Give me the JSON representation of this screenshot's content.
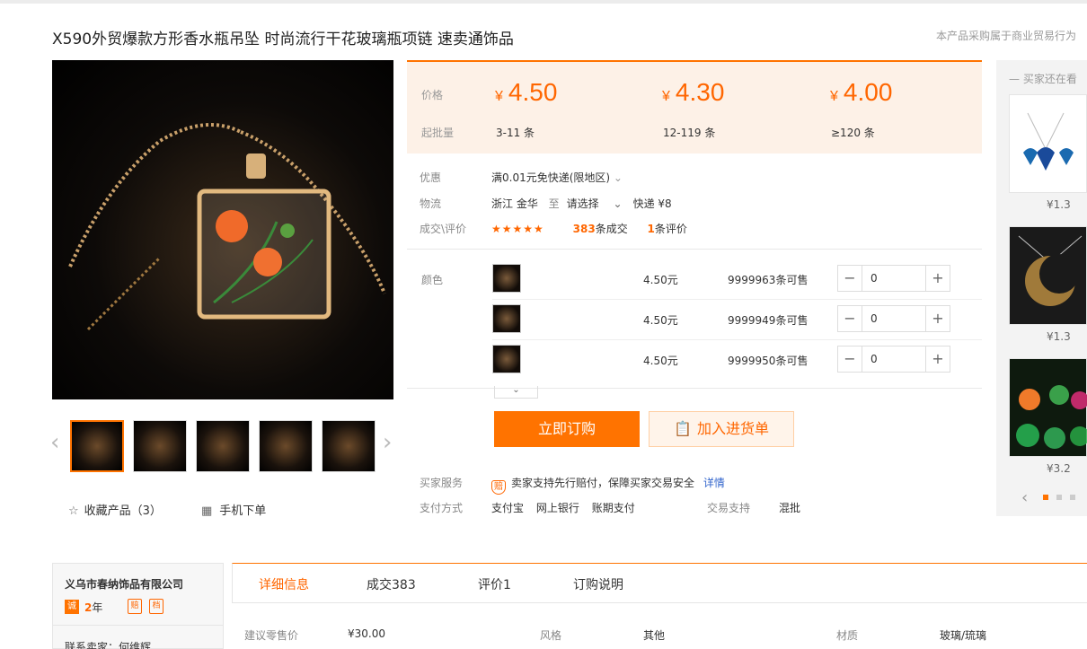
{
  "title": "X590外贸爆款方形香水瓶吊坠 时尚流行干花玻璃瓶项链 速卖通饰品",
  "notice": "本产品采购属于商业贸易行为",
  "prices": {
    "price_label": "价格",
    "qty_label": "起批量",
    "currency": "¥",
    "tiers": [
      {
        "price": "4.50",
        "qty": "3-11 条"
      },
      {
        "price": "4.30",
        "qty": "12-119 条"
      },
      {
        "price": "4.00",
        "qty": "≥120 条"
      }
    ]
  },
  "discount": {
    "label": "优惠",
    "value": "满0.01元免快递(限地区)"
  },
  "logistics": {
    "label": "物流",
    "origin": "浙江 金华",
    "to": "至",
    "dest": "请选择",
    "express": "快递 ¥8"
  },
  "deals": {
    "label": "成交\\评价",
    "stars": "★★★★★",
    "sold_num": "383",
    "sold_unit": "条成交",
    "review_num": "1",
    "review_unit": "条评价"
  },
  "sku": {
    "label": "颜色",
    "rows": [
      {
        "price": "4.50元",
        "stock": "9999963条可售",
        "qty": "0"
      },
      {
        "price": "4.50元",
        "stock": "9999949条可售",
        "qty": "0"
      },
      {
        "price": "4.50元",
        "stock": "9999950条可售",
        "qty": "0"
      }
    ]
  },
  "actions": {
    "buy": "立即订购",
    "cart": "加入进货单"
  },
  "service": {
    "label": "买家服务",
    "text": "卖家支持先行赔付，保障买家交易安全",
    "link": "详情",
    "shield": "赔"
  },
  "payment": {
    "label": "支付方式",
    "methods": [
      "支付宝",
      "网上银行",
      "账期支付"
    ]
  },
  "trade": {
    "label": "交易支持",
    "value": "混批"
  },
  "gallery": {
    "fav": "收藏产品（3）",
    "mobile": "手机下单"
  },
  "rail": {
    "title": "买家还在看",
    "prices": [
      "¥1.3",
      "¥1.3",
      "¥3.2"
    ]
  },
  "seller": {
    "name": "义乌市春纳饰品有限公司",
    "badge": "诚",
    "years_num": "2",
    "years_unit": "年",
    "b1": "赔",
    "b2": "档",
    "contact": "联系卖家：何维辉"
  },
  "tabs": [
    "详细信息",
    "成交383",
    "评价1",
    "订购说明"
  ],
  "attrs": [
    {
      "label": "建议零售价",
      "value": "¥30.00"
    },
    {
      "label": "风格",
      "value": "其他"
    },
    {
      "label": "材质",
      "value": "玻璃/琉璃"
    }
  ],
  "icons": {
    "star": "star-icon",
    "qr": "qr-icon",
    "chevron": "chevron-down-icon",
    "clipboard": "clipboard-icon"
  },
  "colors": {
    "accent": "#ff7300",
    "price": "#ff6600",
    "pricebox_bg": "#fdf1e7"
  }
}
